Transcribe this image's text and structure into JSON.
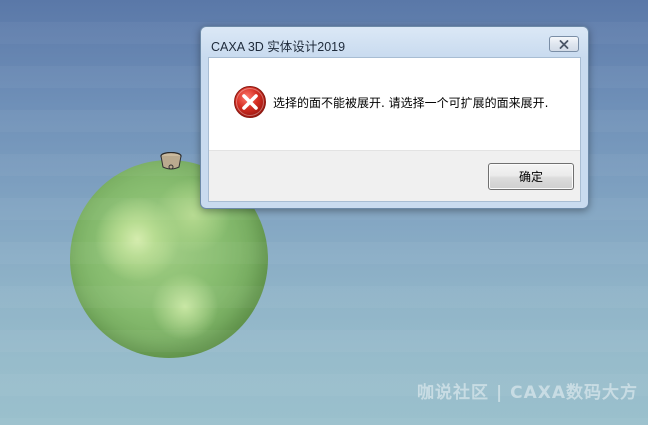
{
  "dialog": {
    "title": "CAXA 3D 实体设计2019",
    "message": "选择的面不能被展开. 请选择一个可扩展的面来展开.",
    "ok_label": "确定",
    "icon": "error-icon",
    "close_icon": "close-icon"
  },
  "viewport": {
    "watermark": "咖说社区 | CAXA数码大方"
  },
  "colors": {
    "background_top": "#5a78a8",
    "background_bottom": "#9ac0cc",
    "sphere": "#88bd70",
    "error_red": "#d42d22"
  }
}
